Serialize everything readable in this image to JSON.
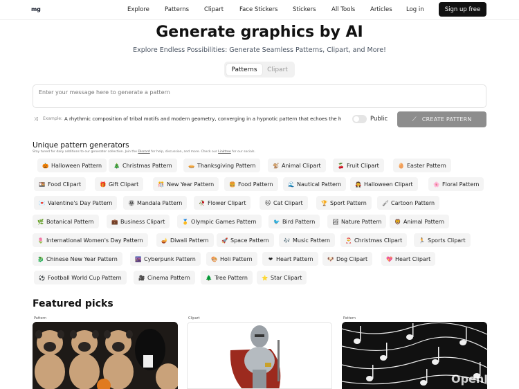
{
  "header": {
    "logo": "mg",
    "nav": [
      "Explore",
      "Patterns",
      "Clipart",
      "Face Stickers",
      "Stickers",
      "All Tools",
      "Articles",
      "Log in"
    ],
    "signup": "Sign up free"
  },
  "hero": {
    "title": "Generate graphics by AI",
    "subtitle": "Explore Endless Possibilities: Generate Seamless Patterns, Clipart, and More!",
    "tabs": [
      "Patterns",
      "Clipart"
    ],
    "active_tab": "Patterns"
  },
  "prompt": {
    "placeholder": "Enter your message here to generate a pattern",
    "example_label": "Example:",
    "example_text": "A rhythmic composition of tribal motifs and modern geometry, converging in a hypnotic pattern that echoes the h",
    "public_label": "Public",
    "public_on": false,
    "create_label": "CREATE PATTERN"
  },
  "generators": {
    "title": "Unique pattern generators",
    "desc_prefix": "Stay tuned for daily additions to our generator collection. Join the ",
    "desc_link1": "Discord",
    "desc_middle": " for help, discussion, and more. Check our ",
    "desc_link2": "Linktree",
    "desc_suffix": " for our socials.",
    "items": [
      {
        "icon": "🎃",
        "label": "Halloween Pattern"
      },
      {
        "icon": "🎄",
        "label": "Christmas Pattern"
      },
      {
        "icon": "🥧",
        "label": "Thanksgiving Pattern"
      },
      {
        "icon": "🐒",
        "label": "Animal Clipart"
      },
      {
        "icon": "🍒",
        "label": "Fruit Clipart"
      },
      {
        "icon": "🥚",
        "label": "Easter Pattern"
      },
      {
        "icon": "🍱",
        "label": "Food Clipart"
      },
      {
        "icon": "🎁",
        "label": "Gift Clipart"
      },
      {
        "icon": "🎊",
        "label": "New Year Pattern"
      },
      {
        "icon": "🍔",
        "label": "Food Pattern"
      },
      {
        "icon": "🌊",
        "label": "Nautical Pattern"
      },
      {
        "icon": "🧛",
        "label": "Halloween Clipart"
      },
      {
        "icon": "🌸",
        "label": "Floral Pattern"
      },
      {
        "icon": "💌",
        "label": "Valentine's Day Pattern"
      },
      {
        "icon": "🏵",
        "label": "Mandala Pattern"
      },
      {
        "icon": "🥀",
        "label": "Flower Clipart"
      },
      {
        "icon": "🐱",
        "label": "Cat Clipart"
      },
      {
        "icon": "🏆",
        "label": "Sport Pattern"
      },
      {
        "icon": "🖌",
        "label": "Cartoon Pattern"
      },
      {
        "icon": "🌿",
        "label": "Botanical Pattern"
      },
      {
        "icon": "💼",
        "label": "Business Clipart"
      },
      {
        "icon": "🥇",
        "label": "Olympic Games Pattern"
      },
      {
        "icon": "🐦",
        "label": "Bird Pattern"
      },
      {
        "icon": "🏞",
        "label": "Nature Pattern"
      },
      {
        "icon": "🦁",
        "label": "Animal Pattern"
      },
      {
        "icon": "🌷",
        "label": "International Women's Day Pattern"
      },
      {
        "icon": "🪔",
        "label": "Diwali Pattern"
      },
      {
        "icon": "🚀",
        "label": "Space Pattern"
      },
      {
        "icon": "🎶",
        "label": "Music Pattern"
      },
      {
        "icon": "🎅",
        "label": "Christmas Clipart"
      },
      {
        "icon": "🏃",
        "label": "Sports Clipart"
      },
      {
        "icon": "🐉",
        "label": "Chinese New Year Pattern"
      },
      {
        "icon": "🌆",
        "label": "Cyberpunk Pattern"
      },
      {
        "icon": "🎨",
        "label": "Holi Pattern"
      },
      {
        "icon": "❤",
        "label": "Heart Pattern"
      },
      {
        "icon": "🐶",
        "label": "Dog Clipart"
      },
      {
        "icon": "💖",
        "label": "Heart Clipart"
      },
      {
        "icon": "⚽",
        "label": "Football World Cup Pattern"
      },
      {
        "icon": "🎥",
        "label": "Cinema Pattern"
      },
      {
        "icon": "🌲",
        "label": "Tree Pattern"
      },
      {
        "icon": "⭐",
        "label": "Star Clipart"
      }
    ]
  },
  "featured": {
    "title": "Featured picks",
    "cards": [
      {
        "label": "Pattern",
        "icon": "pug-pattern-image"
      },
      {
        "label": "Clipart",
        "icon": "knight-clipart-image"
      },
      {
        "label": "Pattern",
        "icon": "music-notes-pattern-image"
      }
    ]
  },
  "watermark": "OpenI.cn"
}
